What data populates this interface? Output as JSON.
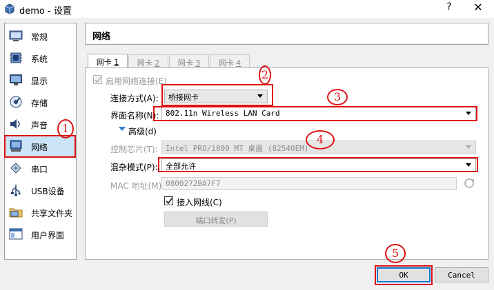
{
  "window": {
    "title": "demo - 设置",
    "help_label": "?",
    "close_label": "✕"
  },
  "sidebar": {
    "items": [
      {
        "label": "常规",
        "icon": "general-icon"
      },
      {
        "label": "系统",
        "icon": "system-icon"
      },
      {
        "label": "显示",
        "icon": "display-icon"
      },
      {
        "label": "存储",
        "icon": "storage-icon"
      },
      {
        "label": "声音",
        "icon": "audio-icon"
      },
      {
        "label": "网络",
        "icon": "network-icon",
        "active": true
      },
      {
        "label": "串口",
        "icon": "serial-icon"
      },
      {
        "label": "USB设备",
        "icon": "usb-icon"
      },
      {
        "label": "共享文件夹",
        "icon": "shared-folder-icon"
      },
      {
        "label": "用户界面",
        "icon": "user-interface-icon"
      }
    ]
  },
  "header": {
    "title": "网络"
  },
  "tabs": [
    {
      "label": "网卡 ",
      "key": "1",
      "active": true
    },
    {
      "label": "网卡 ",
      "key": "2"
    },
    {
      "label": "网卡 ",
      "key": "3"
    },
    {
      "label": "网卡 ",
      "key": "4"
    }
  ],
  "form": {
    "enable_label": "启用网络连接(E)",
    "attach_label": "连接方式(A):",
    "attach_value": "桥接网卡",
    "name_label": "界面名称(N):",
    "name_value": "802.11n Wireless LAN Card",
    "advanced_label": "高级(d)",
    "adapter_label": "控制芯片(T):",
    "adapter_value": "Intel PRO/1000 MT 桌面 (82540EM)",
    "promisc_label": "混杂模式(P):",
    "promisc_value": "全部允许",
    "mac_label": "MAC 地址(M):",
    "mac_value": "0800272BA7F7",
    "cable_label": "接入网线(C)",
    "port_forward_label": "端口转发(P)"
  },
  "buttons": {
    "ok": "OK",
    "cancel": "Cancel"
  },
  "annotations": [
    "1",
    "2",
    "3",
    "4",
    "5"
  ],
  "colors": {
    "annotation": "#e01010",
    "selection": "#cce4f7",
    "focus": "#0078d7"
  }
}
